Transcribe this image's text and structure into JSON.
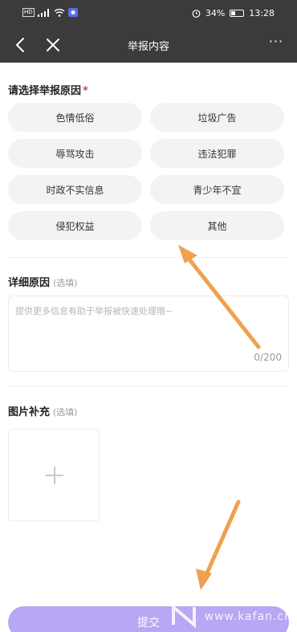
{
  "status_bar": {
    "left_text": "HD",
    "battery": "34%",
    "time": "13:28",
    "battery_level": 0.34
  },
  "nav": {
    "title": "举报内容",
    "more": "···"
  },
  "reason_section": {
    "title": "请选择举报原因",
    "required_mark": "*",
    "options": [
      "色情低俗",
      "垃圾广告",
      "辱骂攻击",
      "违法犯罪",
      "时政不实信息",
      "青少年不宜",
      "侵犯权益",
      "其他"
    ]
  },
  "detail_section": {
    "title": "详细原因",
    "optional": "(选填)",
    "placeholder": "提供更多信息有助于举报被快速处理哦~",
    "counter": "0/200"
  },
  "image_section": {
    "title": "图片补充",
    "optional": "(选填)"
  },
  "submit_label": "提交",
  "watermark": "www.kafan.cn",
  "colors": {
    "header_bg": "#3b3b3b",
    "chip_bg": "#f3f3f3",
    "submit_bg": "#b9a6f4",
    "required": "#e03b3b",
    "arrow": "#f0a050"
  }
}
